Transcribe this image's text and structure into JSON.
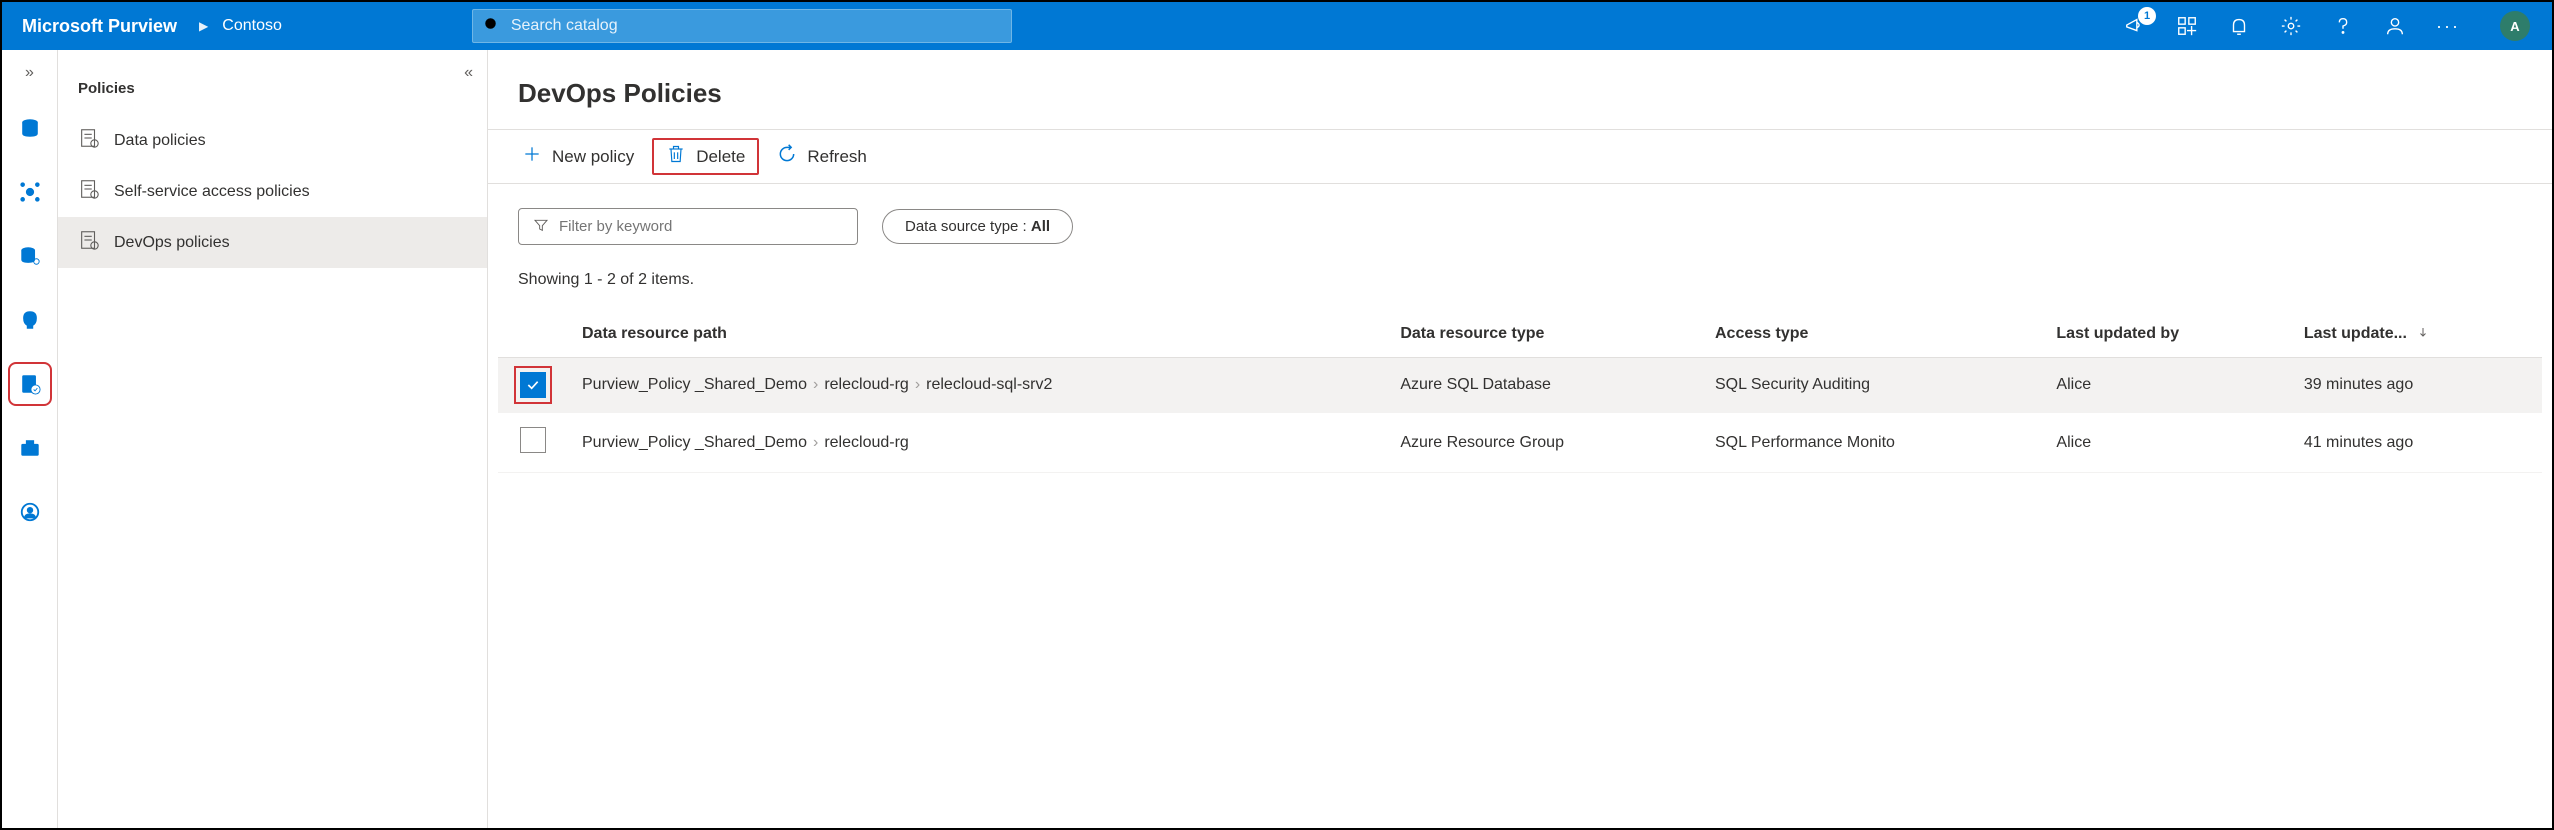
{
  "header": {
    "app_title": "Microsoft Purview",
    "breadcrumb": "Contoso",
    "search_placeholder": "Search catalog",
    "badge_count": "1",
    "avatar_initial": "A"
  },
  "sidebar": {
    "title": "Policies",
    "items": [
      {
        "label": "Data policies"
      },
      {
        "label": "Self-service access policies"
      },
      {
        "label": "DevOps policies"
      }
    ]
  },
  "main": {
    "page_title": "DevOps Policies",
    "toolbar": {
      "new_label": "New policy",
      "delete_label": "Delete",
      "refresh_label": "Refresh"
    },
    "filters": {
      "keyword_placeholder": "Filter by keyword",
      "type_label": "Data source type : ",
      "type_value": "All"
    },
    "showing_text": "Showing 1 - 2 of 2 items.",
    "columns": {
      "path": "Data resource path",
      "type": "Data resource type",
      "access": "Access type",
      "updated_by": "Last updated by",
      "updated": "Last update..."
    },
    "rows": [
      {
        "checked": true,
        "path_parts": [
          "Purview_Policy _Shared_Demo",
          "relecloud-rg",
          "relecloud-sql-srv2"
        ],
        "type": "Azure SQL Database",
        "access": "SQL Security Auditing",
        "updated_by": "Alice",
        "updated": "39 minutes ago"
      },
      {
        "checked": false,
        "path_parts": [
          "Purview_Policy _Shared_Demo",
          "relecloud-rg"
        ],
        "type": "Azure Resource Group",
        "access": "SQL Performance Monito",
        "updated_by": "Alice",
        "updated": "41 minutes ago"
      }
    ]
  }
}
